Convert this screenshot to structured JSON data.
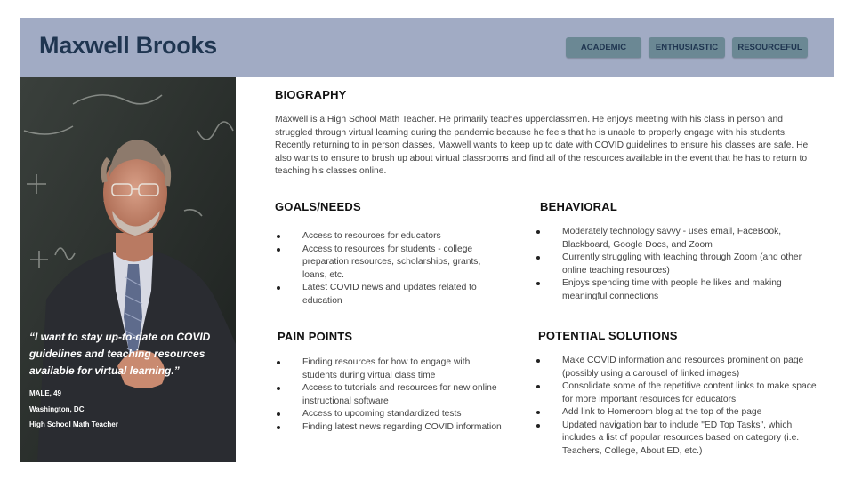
{
  "persona": {
    "name": "Maxwell Brooks",
    "tags": [
      "ACADEMIC",
      "ENTHUSIASTIC",
      "RESOURCEFUL"
    ]
  },
  "profile": {
    "quote": "“I want to stay up-to-date on COVID guidelines and teaching resources available for virtual learning.”",
    "gender_age": "MALE, 49",
    "location": "Washington, DC",
    "occupation": "High School Math Teacher"
  },
  "biography": {
    "title": "BIOGRAPHY",
    "text": "Maxwell is a High School Math Teacher. He primarily teaches upperclassmen. He enjoys meeting with his class in person and struggled through virtual learning during the pandemic because he feels that he is unable to properly engage with his students. Recently returning to in person classes, Maxwell wants to keep up to date with COVID guidelines to ensure his classes are safe. He also wants to ensure to brush up about virtual classrooms and find all of the resources available in the event that he has to return to teaching his classes online."
  },
  "goals": {
    "title": "GOALS/NEEDS",
    "items": [
      "Access to resources for educators",
      "Access to resources for students - college preparation resources, scholarships, grants, loans, etc.",
      "Latest COVID news and updates related to education"
    ]
  },
  "behavioral": {
    "title": "BEHAVIORAL",
    "items": [
      "Moderately technology savvy - uses email, FaceBook, Blackboard, Google Docs, and Zoom",
      "Currently struggling with teaching through Zoom (and other online teaching resources)",
      "Enjoys spending time with people he likes and making meaningful connections"
    ]
  },
  "pain_points": {
    "title": "PAIN POINTS",
    "items": [
      "Finding resources for how to engage with students during virtual class time",
      "Access to tutorials and resources for new online instructional software",
      "Access to upcoming standardized tests",
      "Finding latest news regarding COVID information"
    ]
  },
  "solutions": {
    "title": "POTENTIAL SOLUTIONS",
    "items": [
      "Make COVID information and resources prominent on page (possibly using a carousel of linked images)",
      "Consolidate some of the repetitive content links to make space for more important resources for educators",
      "Add link to Homeroom blog at the top of the page",
      "Updated navigation bar to include \"ED Top Tasks\", which includes a list of popular resources based on category (i.e. Teachers, College, About ED, etc.)"
    ]
  }
}
